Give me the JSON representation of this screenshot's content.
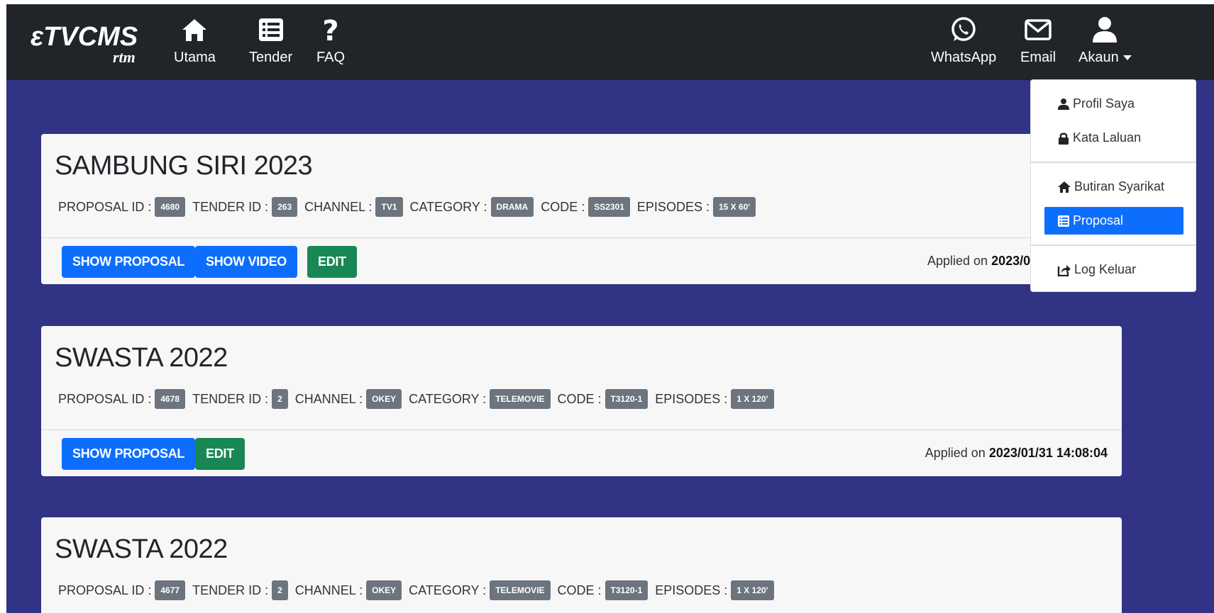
{
  "brand": {
    "logo_text": "ETVCMS",
    "logo_sub": "rtm"
  },
  "nav_left": [
    {
      "label": "Utama",
      "icon": "home-icon"
    },
    {
      "label": "Tender",
      "icon": "list-icon"
    },
    {
      "label": "FAQ",
      "icon": "question-icon"
    }
  ],
  "nav_right": [
    {
      "label": "WhatsApp",
      "icon": "whatsapp-icon"
    },
    {
      "label": "Email",
      "icon": "envelope-icon"
    },
    {
      "label": "Akaun",
      "icon": "user-icon"
    }
  ],
  "dropdown": {
    "items": [
      {
        "label": "Profil Saya",
        "icon": "user-icon"
      },
      {
        "label": "Kata Laluan",
        "icon": "lock-icon"
      },
      {
        "label": "Butiran Syarikat",
        "icon": "home-icon"
      },
      {
        "label": "Proposal",
        "icon": "list-icon",
        "active": true
      },
      {
        "label": "Log Keluar",
        "icon": "share-icon"
      }
    ]
  },
  "field_labels": {
    "proposal_id": "PROPOSAL ID :",
    "tender_id": "TENDER ID :",
    "channel": "CHANNEL :",
    "category": "CATEGORY :",
    "code": "CODE :",
    "episodes": "EPISODES :",
    "applied_on": "Applied on"
  },
  "buttons": {
    "show_proposal": "SHOW PROPOSAL",
    "show_video": "SHOW VIDEO",
    "edit": "EDIT"
  },
  "proposals": [
    {
      "title": "SAMBUNG SIRI 2023",
      "proposal_id": "4680",
      "tender_id": "263",
      "channel": "TV1",
      "category": "DRAMA",
      "code": "SS2301",
      "episodes": "15 X 60'",
      "applied_on": "2023/0"
    },
    {
      "title": "SWASTA 2022",
      "proposal_id": "4678",
      "tender_id": "2",
      "channel": "OKEY",
      "category": "TELEMOVIE",
      "code": "T3120-1",
      "episodes": "1 X 120'",
      "applied_on": "2023/01/31 14:08:04"
    },
    {
      "title": "SWASTA 2022",
      "proposal_id": "4677",
      "tender_id": "2",
      "channel": "OKEY",
      "category": "TELEMOVIE",
      "code": "T3120-1",
      "episodes": "1 X 120'"
    }
  ]
}
